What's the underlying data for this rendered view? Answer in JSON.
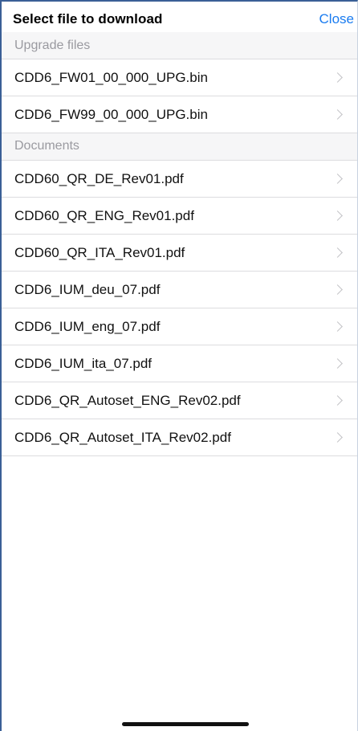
{
  "header": {
    "title": "Select file to download",
    "close_label": "Close"
  },
  "sections": [
    {
      "title": "Upgrade files",
      "items": [
        "CDD6_FW01_00_000_UPG.bin",
        "CDD6_FW99_00_000_UPG.bin"
      ]
    },
    {
      "title": "Documents",
      "items": [
        "CDD60_QR_DE_Rev01.pdf",
        "CDD60_QR_ENG_Rev01.pdf",
        "CDD60_QR_ITA_Rev01.pdf",
        "CDD6_IUM_deu_07.pdf",
        "CDD6_IUM_eng_07.pdf",
        "CDD6_IUM_ita_07.pdf",
        "CDD6_QR_Autoset_ENG_Rev02.pdf",
        "CDD6_QR_Autoset_ITA_Rev02.pdf"
      ]
    }
  ],
  "icons": {
    "row_accessory": "chevron-right-icon"
  },
  "colors": {
    "accent": "#1a7cf0",
    "section_text": "#9a9aa0",
    "separator": "#dcdcdf"
  }
}
